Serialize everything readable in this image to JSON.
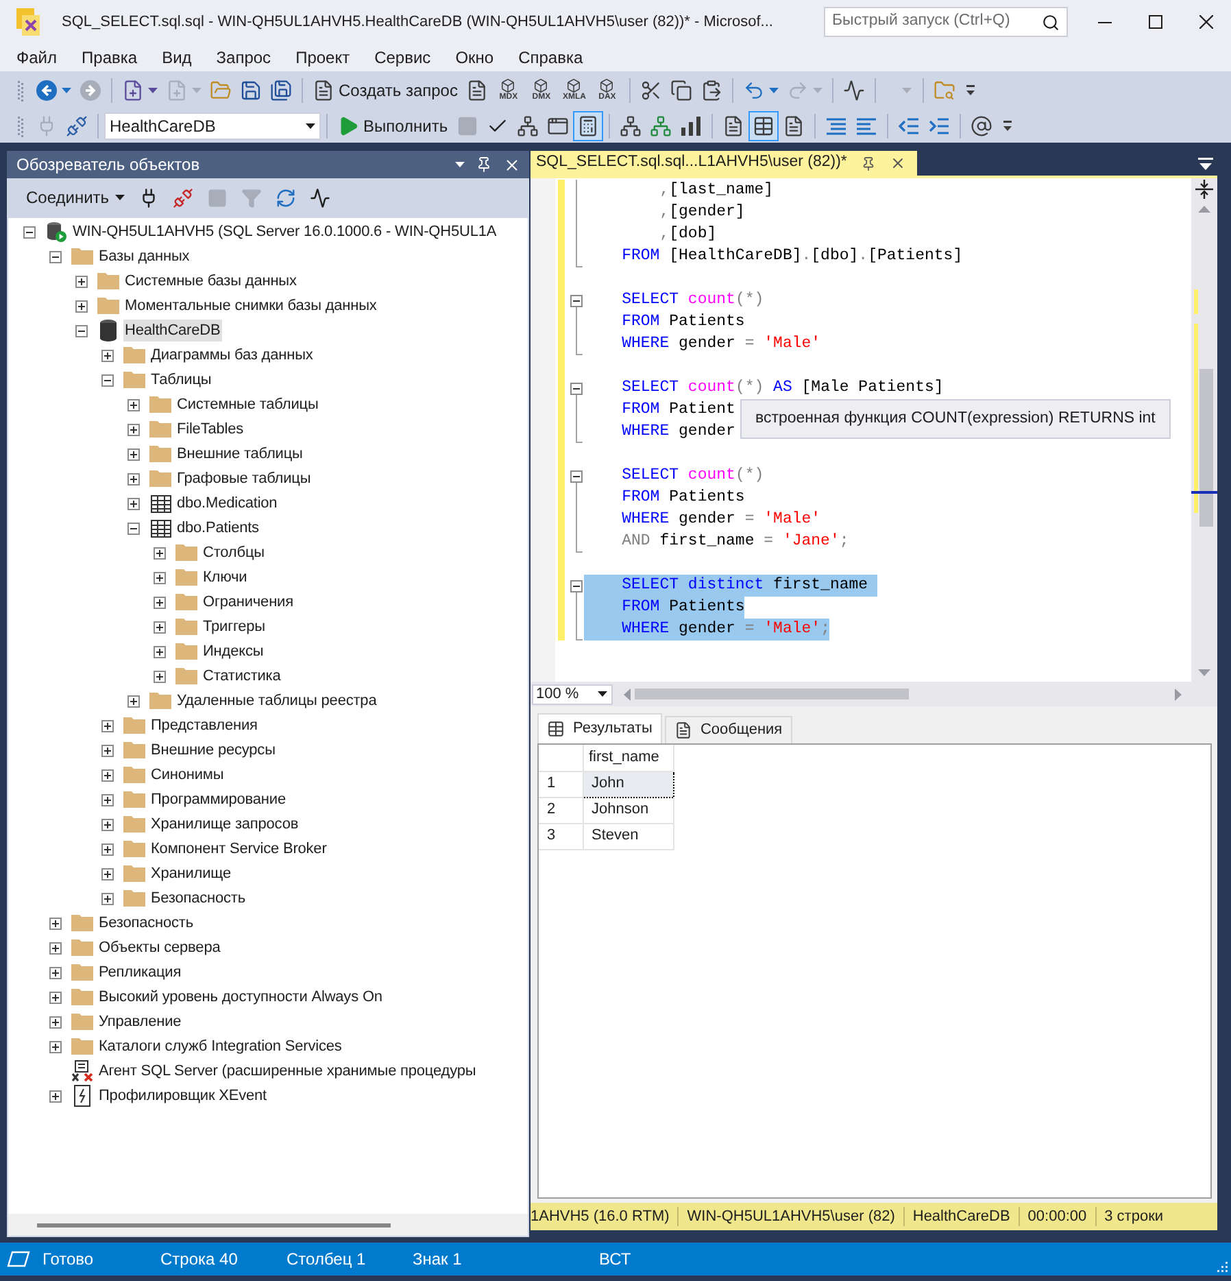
{
  "window": {
    "title": "SQL_SELECT.sql.sql - WIN-QH5UL1AHVH5.HealthCareDB (WIN-QH5UL1AHVH5\\user (82))* - Microsof...",
    "quick_launch": {
      "placeholder": "Быстрый запуск (Ctrl+Q)"
    }
  },
  "menu": [
    "Файл",
    "Правка",
    "Вид",
    "Запрос",
    "Проект",
    "Сервис",
    "Окно",
    "Справка"
  ],
  "toolbars": [
    {
      "groups": [
        [
          {
            "kind": "icon",
            "dropdown": true,
            "disabled": false,
            "selected": false
          },
          {
            "kind": "icon",
            "dropdown": false,
            "disabled": true,
            "selected": false
          }
        ],
        [
          {
            "kind": "icon",
            "dropdown": true,
            "disabled": false,
            "selected": false
          },
          {
            "kind": "icon",
            "dropdown": true,
            "disabled": true,
            "selected": false
          },
          {
            "kind": "icon",
            "dropdown": false,
            "disabled": false,
            "selected": false
          },
          {
            "kind": "icon",
            "dropdown": false,
            "disabled": false,
            "selected": false
          },
          {
            "kind": "icon",
            "dropdown": false,
            "disabled": false,
            "selected": false
          }
        ],
        [
          {
            "kind": "labeled",
            "label": "Создать запрос",
            "disabled": false
          },
          {
            "kind": "icon",
            "dropdown": false,
            "disabled": false,
            "selected": false
          },
          {
            "kind": "captioned",
            "caption": "MDX",
            "disabled": false
          },
          {
            "kind": "captioned",
            "caption": "DMX",
            "disabled": false
          },
          {
            "kind": "captioned",
            "caption": "XMLA",
            "disabled": false
          },
          {
            "kind": "captioned",
            "caption": "DAX",
            "disabled": false
          }
        ],
        [
          {
            "kind": "icon",
            "dropdown": false,
            "disabled": false,
            "selected": false
          },
          {
            "kind": "icon",
            "dropdown": false,
            "disabled": false,
            "selected": false
          },
          {
            "kind": "icon",
            "dropdown": false,
            "disabled": false,
            "selected": false
          }
        ],
        [
          {
            "kind": "icon",
            "dropdown": true,
            "disabled": false,
            "selected": false
          },
          {
            "kind": "icon",
            "dropdown": true,
            "disabled": true,
            "selected": false
          }
        ],
        [
          {
            "kind": "icon",
            "dropdown": false,
            "disabled": false,
            "selected": false
          }
        ],
        [
          {
            "kind": "combo",
            "disabled": true
          }
        ],
        [
          {
            "kind": "icon",
            "dropdown": false,
            "disabled": false,
            "selected": false
          }
        ]
      ]
    },
    {
      "groups": [
        [
          {
            "kind": "icon",
            "dropdown": false,
            "disabled": true,
            "selected": false
          },
          {
            "kind": "icon",
            "dropdown": false,
            "disabled": false,
            "selected": false
          }
        ],
        [
          {
            "kind": "combo",
            "value": "HealthCareDB",
            "disabled": false
          }
        ],
        [
          {
            "kind": "labeled",
            "label": "Выполнить",
            "disabled": false
          },
          {
            "kind": "icon",
            "dropdown": false,
            "disabled": true,
            "selected": false
          },
          {
            "kind": "icon",
            "dropdown": false,
            "disabled": false,
            "selected": false
          },
          {
            "kind": "icon",
            "dropdown": false,
            "disabled": false,
            "selected": false
          },
          {
            "kind": "icon",
            "dropdown": false,
            "disabled": false,
            "selected": false
          },
          {
            "kind": "icon",
            "dropdown": false,
            "disabled": false,
            "selected": true
          }
        ],
        [
          {
            "kind": "icon",
            "dropdown": false,
            "disabled": false,
            "selected": false
          },
          {
            "kind": "icon",
            "dropdown": false,
            "disabled": false,
            "selected": false
          },
          {
            "kind": "icon",
            "dropdown": false,
            "disabled": false,
            "selected": false
          }
        ],
        [
          {
            "kind": "icon",
            "dropdown": false,
            "disabled": false,
            "selected": false
          },
          {
            "kind": "icon",
            "dropdown": false,
            "disabled": false,
            "selected": true
          },
          {
            "kind": "icon",
            "dropdown": false,
            "disabled": false,
            "selected": false
          }
        ],
        [
          {
            "kind": "icon",
            "dropdown": false,
            "disabled": false,
            "selected": false
          },
          {
            "kind": "icon",
            "dropdown": false,
            "disabled": false,
            "selected": false
          }
        ],
        [
          {
            "kind": "icon",
            "dropdown": false,
            "disabled": false,
            "selected": false
          },
          {
            "kind": "icon",
            "dropdown": false,
            "disabled": false,
            "selected": false
          }
        ],
        [
          {
            "kind": "icon",
            "dropdown": false,
            "disabled": false,
            "selected": false
          }
        ]
      ]
    }
  ],
  "object_explorer": {
    "title": "Обозреватель объектов",
    "toolbar": {
      "connect": {
        "label": "Соединить"
      },
      "buttons": [
        {
          "disabled": false
        },
        {
          "disabled": false
        },
        {
          "disabled": true
        },
        {
          "disabled": true
        },
        {
          "disabled": false
        },
        {
          "disabled": false
        }
      ]
    },
    "tree": [
      {
        "label": "WIN-QH5UL1AHVH5 (SQL Server 16.0.1000.6 - WIN-QH5UL1A",
        "kind": "server",
        "expanded": true,
        "selected": false,
        "children": [
          {
            "label": "Базы данных",
            "kind": "folder",
            "expanded": true,
            "selected": false,
            "children": [
              {
                "label": "Системные базы данных",
                "kind": "folder",
                "expanded": false,
                "selected": false
              },
              {
                "label": "Моментальные снимки базы данных",
                "kind": "folder",
                "expanded": false,
                "selected": false
              },
              {
                "label": "HealthCareDB",
                "kind": "database",
                "expanded": true,
                "selected": true,
                "children": [
                  {
                    "label": "Диаграммы баз данных",
                    "kind": "folder",
                    "expanded": false,
                    "selected": false
                  },
                  {
                    "label": "Таблицы",
                    "kind": "folder",
                    "expanded": true,
                    "selected": false,
                    "children": [
                      {
                        "label": "Системные таблицы",
                        "kind": "folder",
                        "expanded": false,
                        "selected": false
                      },
                      {
                        "label": "FileTables",
                        "kind": "folder",
                        "expanded": false,
                        "selected": false
                      },
                      {
                        "label": "Внешние таблицы",
                        "kind": "folder",
                        "expanded": false,
                        "selected": false
                      },
                      {
                        "label": "Графовые таблицы",
                        "kind": "folder",
                        "expanded": false,
                        "selected": false
                      },
                      {
                        "label": "dbo.Medication",
                        "kind": "table",
                        "expanded": false,
                        "selected": false
                      },
                      {
                        "label": "dbo.Patients",
                        "kind": "table",
                        "expanded": true,
                        "selected": false,
                        "children": [
                          {
                            "label": "Столбцы",
                            "kind": "folder",
                            "expanded": false,
                            "selected": false
                          },
                          {
                            "label": "Ключи",
                            "kind": "folder",
                            "expanded": false,
                            "selected": false
                          },
                          {
                            "label": "Ограничения",
                            "kind": "folder",
                            "expanded": false,
                            "selected": false
                          },
                          {
                            "label": "Триггеры",
                            "kind": "folder",
                            "expanded": false,
                            "selected": false
                          },
                          {
                            "label": "Индексы",
                            "kind": "folder",
                            "expanded": false,
                            "selected": false
                          },
                          {
                            "label": "Статистика",
                            "kind": "folder",
                            "expanded": false,
                            "selected": false
                          }
                        ]
                      },
                      {
                        "label": "Удаленные таблицы реестра",
                        "kind": "folder",
                        "expanded": false,
                        "selected": false
                      }
                    ]
                  },
                  {
                    "label": "Представления",
                    "kind": "folder",
                    "expanded": false,
                    "selected": false
                  },
                  {
                    "label": "Внешние ресурсы",
                    "kind": "folder",
                    "expanded": false,
                    "selected": false
                  },
                  {
                    "label": "Синонимы",
                    "kind": "folder",
                    "expanded": false,
                    "selected": false
                  },
                  {
                    "label": "Программирование",
                    "kind": "folder",
                    "expanded": false,
                    "selected": false
                  },
                  {
                    "label": "Хранилище запросов",
                    "kind": "folder",
                    "expanded": false,
                    "selected": false
                  },
                  {
                    "label": "Компонент Service Broker",
                    "kind": "folder",
                    "expanded": false,
                    "selected": false
                  },
                  {
                    "label": "Хранилище",
                    "kind": "folder",
                    "expanded": false,
                    "selected": false
                  },
                  {
                    "label": "Безопасность",
                    "kind": "folder",
                    "expanded": false,
                    "selected": false
                  }
                ]
              }
            ]
          },
          {
            "label": "Безопасность",
            "kind": "folder",
            "expanded": false,
            "selected": false
          },
          {
            "label": "Объекты сервера",
            "kind": "folder",
            "expanded": false,
            "selected": false
          },
          {
            "label": "Репликация",
            "kind": "folder",
            "expanded": false,
            "selected": false
          },
          {
            "label": "Высокий уровень доступности Always On",
            "kind": "folder",
            "expanded": false,
            "selected": false
          },
          {
            "label": "Управление",
            "kind": "folder",
            "expanded": false,
            "selected": false
          },
          {
            "label": "Каталоги служб Integration Services",
            "kind": "folder",
            "expanded": false,
            "selected": false
          },
          {
            "label": "Агент SQL Server (расширенные хранимые процедуры",
            "kind": "agent",
            "selected": false
          },
          {
            "label": "Профилировщик XEvent",
            "kind": "profiler",
            "expanded": false,
            "selected": false
          }
        ]
      }
    ]
  },
  "editor": {
    "tab": {
      "title": "SQL_SELECT.sql.sql...L1AHVH5\\user (82))*",
      "selected": true
    },
    "blocks": [
      {
        "kind": "partial",
        "lines": [
          {
            "selected": false,
            "tokens": [
              {
                "kind": "operator",
                "text": "        ,"
              },
              {
                "kind": "plain",
                "text": "[last_name]"
              }
            ]
          },
          {
            "selected": false,
            "tokens": [
              {
                "kind": "operator",
                "text": "        ,"
              },
              {
                "kind": "plain",
                "text": "[gender]"
              }
            ]
          },
          {
            "selected": false,
            "tokens": [
              {
                "kind": "operator",
                "text": "        ,"
              },
              {
                "kind": "plain",
                "text": "[dob]"
              }
            ]
          },
          {
            "selected": false,
            "tokens": [
              {
                "kind": "keyword",
                "text": "    FROM "
              },
              {
                "kind": "plain",
                "text": "[HealthCareDB]"
              },
              {
                "kind": "operator",
                "text": "."
              },
              {
                "kind": "plain",
                "text": "[dbo]"
              },
              {
                "kind": "operator",
                "text": "."
              },
              {
                "kind": "plain",
                "text": "[Patients]"
              }
            ]
          }
        ]
      },
      {
        "kind": "full",
        "expanded": true,
        "lines": [
          {
            "selected": false,
            "tokens": [
              {
                "kind": "keyword",
                "text": "    SELECT "
              },
              {
                "kind": "function",
                "text": "count"
              },
              {
                "kind": "operator",
                "text": "(*)"
              }
            ]
          },
          {
            "selected": false,
            "tokens": [
              {
                "kind": "keyword",
                "text": "    FROM "
              },
              {
                "kind": "plain",
                "text": "Patients"
              }
            ]
          },
          {
            "selected": false,
            "tokens": [
              {
                "kind": "keyword",
                "text": "    WHERE "
              },
              {
                "kind": "plain",
                "text": "gender "
              },
              {
                "kind": "operator",
                "text": "= "
              },
              {
                "kind": "string",
                "text": "'Male'"
              }
            ]
          }
        ]
      },
      {
        "kind": "full",
        "expanded": true,
        "lines": [
          {
            "selected": false,
            "tokens": [
              {
                "kind": "keyword",
                "text": "    SELECT "
              },
              {
                "kind": "function",
                "text": "count"
              },
              {
                "kind": "operator",
                "text": "(*) "
              },
              {
                "kind": "keyword",
                "text": "AS "
              },
              {
                "kind": "plain",
                "text": "[Male Patients]"
              }
            ]
          },
          {
            "selected": false,
            "tokens": [
              {
                "kind": "keyword",
                "text": "    FROM "
              },
              {
                "kind": "plain",
                "text": "Patient"
              }
            ]
          },
          {
            "selected": false,
            "tokens": [
              {
                "kind": "keyword",
                "text": "    WHERE "
              },
              {
                "kind": "plain",
                "text": "gender"
              }
            ]
          }
        ]
      },
      {
        "kind": "full",
        "expanded": true,
        "lines": [
          {
            "selected": false,
            "tokens": [
              {
                "kind": "keyword",
                "text": "    SELECT "
              },
              {
                "kind": "function",
                "text": "count"
              },
              {
                "kind": "operator",
                "text": "(*)"
              }
            ]
          },
          {
            "selected": false,
            "tokens": [
              {
                "kind": "keyword",
                "text": "    FROM "
              },
              {
                "kind": "plain",
                "text": "Patients"
              }
            ]
          },
          {
            "selected": false,
            "tokens": [
              {
                "kind": "keyword",
                "text": "    WHERE "
              },
              {
                "kind": "plain",
                "text": "gender "
              },
              {
                "kind": "operator",
                "text": "= "
              },
              {
                "kind": "string",
                "text": "'Male'"
              }
            ]
          },
          {
            "selected": false,
            "tokens": [
              {
                "kind": "operator",
                "text": "    AND "
              },
              {
                "kind": "plain",
                "text": "first_name "
              },
              {
                "kind": "operator",
                "text": "= "
              },
              {
                "kind": "string",
                "text": "'Jane'"
              },
              {
                "kind": "operator",
                "text": ";"
              }
            ]
          }
        ]
      },
      {
        "kind": "full",
        "expanded": true,
        "lines": [
          {
            "selected": true,
            "tokens": [
              {
                "kind": "keyword",
                "text": "    SELECT "
              },
              {
                "kind": "keyword",
                "text": "distinct "
              },
              {
                "kind": "plain",
                "text": "first_name "
              }
            ]
          },
          {
            "selected": true,
            "tokens": [
              {
                "kind": "keyword",
                "text": "    FROM "
              },
              {
                "kind": "plain",
                "text": "Patients"
              }
            ]
          },
          {
            "selected": true,
            "tokens": [
              {
                "kind": "keyword",
                "text": "    WHERE "
              },
              {
                "kind": "plain",
                "text": "gender "
              },
              {
                "kind": "operator",
                "text": "= "
              },
              {
                "kind": "string",
                "text": "'Male'"
              },
              {
                "kind": "operator",
                "text": ";"
              }
            ]
          }
        ]
      }
    ],
    "tooltip": {
      "text": "встроенная функция COUNT(expression) RETURNS int"
    },
    "zoom": "100 %"
  },
  "results": {
    "tabs": [
      {
        "label": "Результаты",
        "selected": true
      },
      {
        "label": "Сообщения",
        "selected": false
      }
    ],
    "columns": [
      "first_name"
    ],
    "rows": [
      {
        "number": "1",
        "cells": [
          "John"
        ],
        "selected": true
      },
      {
        "number": "2",
        "cells": [
          "Johnson"
        ],
        "selected": false
      },
      {
        "number": "3",
        "cells": [
          "Steven"
        ],
        "selected": false
      }
    ]
  },
  "query_status": [
    "1AHVH5 (16.0 RTM)",
    "WIN-QH5UL1AHVH5\\user (82)",
    "HealthCareDB",
    "00:00:00",
    "3 строки"
  ],
  "status_bar": {
    "ready": "Готово",
    "items": [
      "Строка 40",
      "Столбец 1",
      "Знак 1",
      "ВСТ"
    ]
  }
}
